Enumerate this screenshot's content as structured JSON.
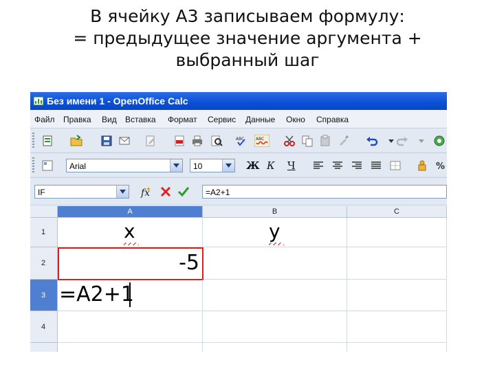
{
  "slide": {
    "title_lines": [
      "В ячейку А3 записываем формулу:",
      "= предыдущее значение аргумента +",
      "выбранный шаг"
    ]
  },
  "window": {
    "title": "Без имени 1 - OpenOffice Calc"
  },
  "menu": [
    "Файл",
    "Правка",
    "Вид",
    "Вставка",
    "Формат",
    "Сервис",
    "Данные",
    "Окно",
    "Справка"
  ],
  "toolbar_format": {
    "font_name": "Arial",
    "font_size": "10",
    "bold_label": "Ж",
    "italic_label": "К",
    "underline_label": "Ч"
  },
  "formula_bar": {
    "name_box": "IF",
    "formula": "=A2+1"
  },
  "sheet": {
    "columns": [
      "A",
      "B",
      "C"
    ],
    "rows": [
      "1",
      "2",
      "3",
      "4"
    ],
    "cells": {
      "A1": "x",
      "B1": "y",
      "A2": "-5",
      "A3": "=A2+1"
    }
  },
  "colors": {
    "titlebar": "#0a4fd6",
    "selection_border": "#d91e1e",
    "active_header": "#4f7fd1"
  }
}
